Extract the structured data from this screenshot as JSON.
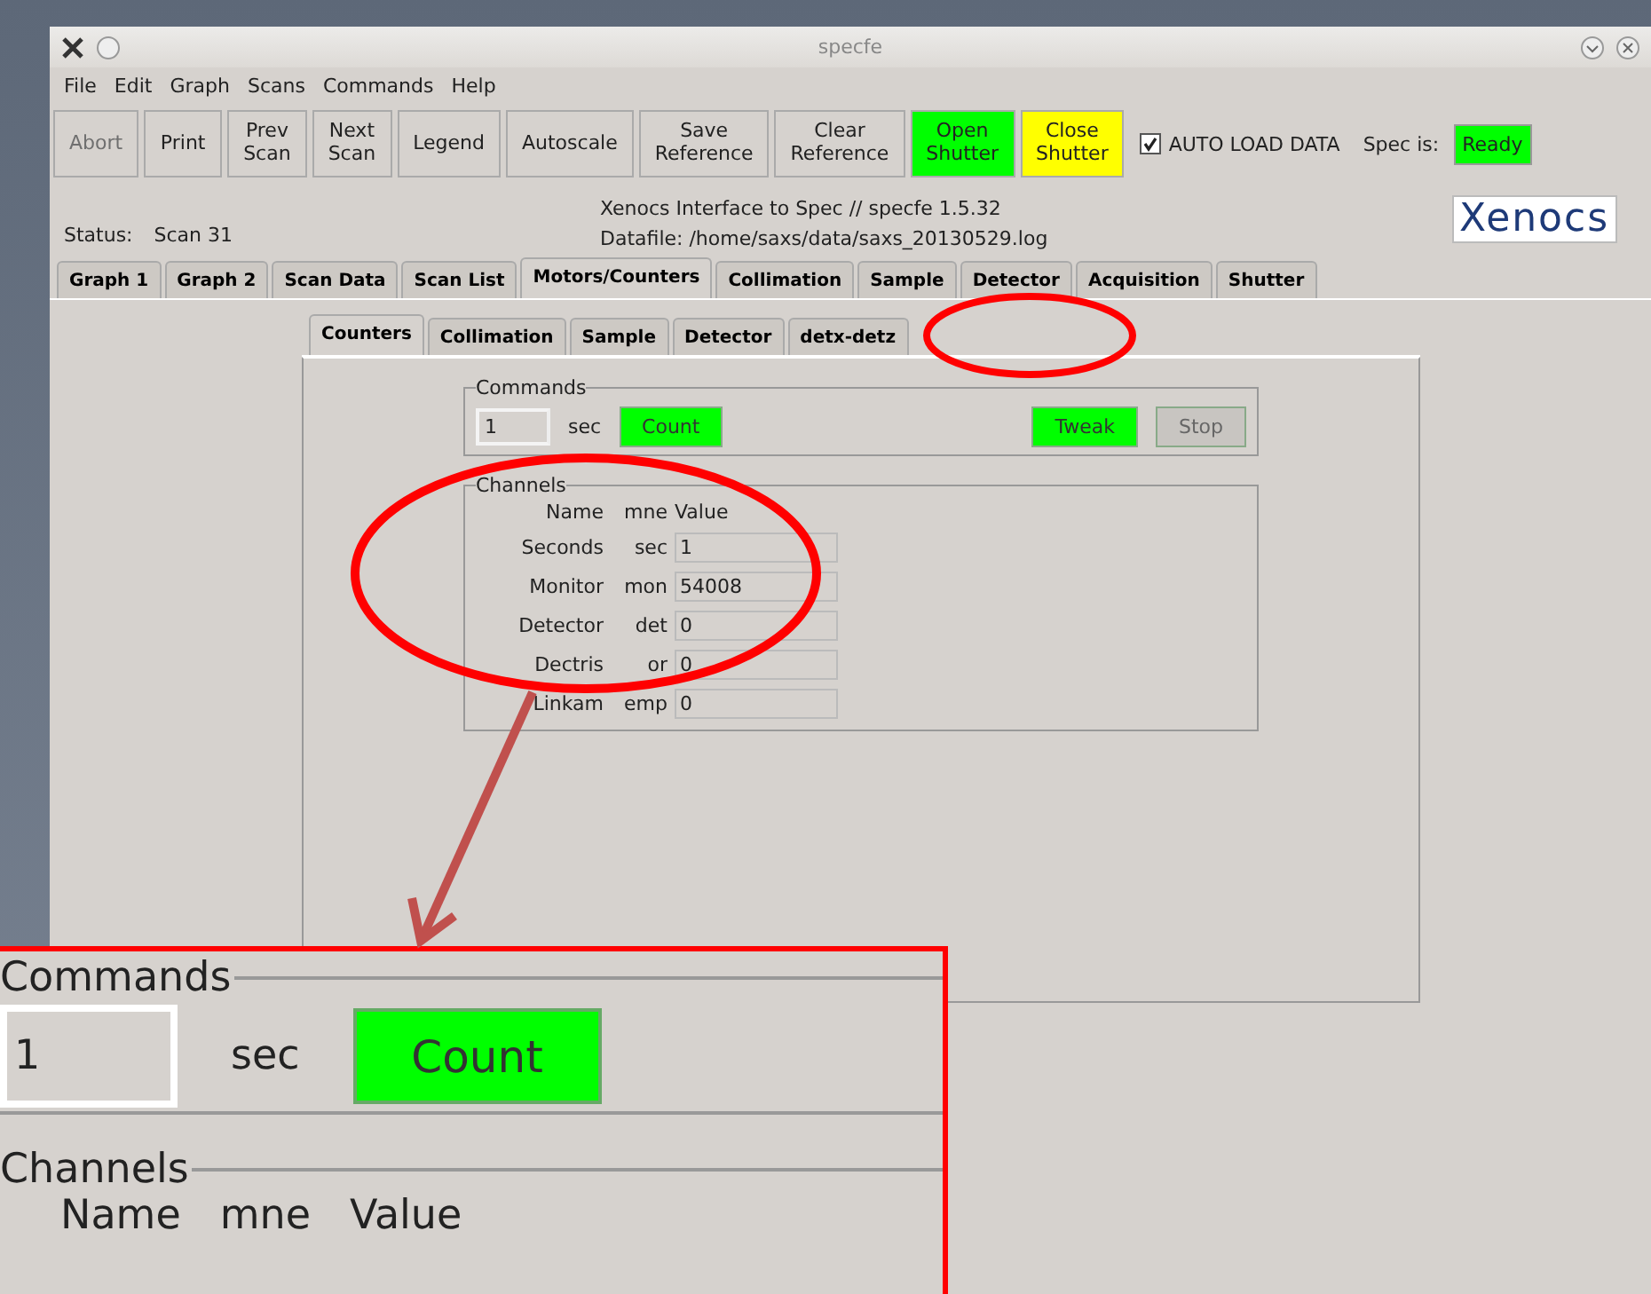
{
  "window": {
    "title": "specfe"
  },
  "menu": [
    "File",
    "Edit",
    "Graph",
    "Scans",
    "Commands",
    "Help"
  ],
  "toolbar": [
    {
      "label": "Abort",
      "color": "#d6d2ce",
      "disabled": true
    },
    {
      "label": "Print",
      "color": "#d6d2ce",
      "disabled": false
    },
    {
      "label": "Prev Scan",
      "color": "#d6d2ce",
      "disabled": false
    },
    {
      "label": "Next Scan",
      "color": "#d6d2ce",
      "disabled": false
    },
    {
      "label": "Legend",
      "color": "#d6d2ce",
      "disabled": false
    },
    {
      "label": "Autoscale",
      "color": "#d6d2ce",
      "disabled": false
    },
    {
      "label": "Save Reference",
      "color": "#d6d2ce",
      "disabled": false
    },
    {
      "label": "Clear Reference",
      "color": "#d6d2ce",
      "disabled": false
    },
    {
      "label": "Open Shutter",
      "color": "#00ff00",
      "disabled": false
    },
    {
      "label": "Close Shutter",
      "color": "#ffff00",
      "disabled": false
    }
  ],
  "auto_load": {
    "label": "AUTO LOAD DATA",
    "checked": true
  },
  "spec_status": {
    "label": "Spec is:",
    "value": "Ready",
    "color": "#00ff00"
  },
  "info": {
    "title": "Xenocs Interface to Spec // specfe 1.5.32",
    "datafile": "Datafile: /home/saxs/data/saxs_20130529.log",
    "status_label": "Status:",
    "status_value": "Scan 31",
    "logo": "Xenocs"
  },
  "tabs": [
    {
      "label": "Graph 1",
      "selected": false
    },
    {
      "label": "Graph 2",
      "selected": false
    },
    {
      "label": "Scan Data",
      "selected": false
    },
    {
      "label": "Scan List",
      "selected": false
    },
    {
      "label": "Motors/Counters",
      "selected": true
    },
    {
      "label": "Collimation",
      "selected": false
    },
    {
      "label": "Sample",
      "selected": false
    },
    {
      "label": "Detector",
      "selected": false
    },
    {
      "label": "Acquisition",
      "selected": false
    },
    {
      "label": "Shutter",
      "selected": false
    }
  ],
  "subtabs": [
    {
      "label": "Counters",
      "selected": true
    },
    {
      "label": "Collimation",
      "selected": false
    },
    {
      "label": "Sample",
      "selected": false
    },
    {
      "label": "Detector",
      "selected": false
    },
    {
      "label": "detx-detz",
      "selected": false
    }
  ],
  "commands": {
    "legend": "Commands",
    "time": "1",
    "unit": "sec",
    "count": {
      "label": "Count",
      "disabled": false
    },
    "actions": [
      {
        "label": "Tweak",
        "disabled": false
      },
      {
        "label": "Stop",
        "disabled": true
      }
    ]
  },
  "channels": {
    "legend": "Channels",
    "headers": [
      "Name",
      "mne",
      "Value"
    ],
    "rows": [
      {
        "name": "Seconds",
        "mne": "sec",
        "value": "1"
      },
      {
        "name": "Monitor",
        "mne": "mon",
        "value": "54008"
      },
      {
        "name": "Detector",
        "mne": "det",
        "value": "0"
      },
      {
        "name": "Dectris",
        "mne": "or",
        "value": "0"
      },
      {
        "name": "Linkam",
        "mne": "emp",
        "value": "0"
      }
    ]
  },
  "inset": {
    "legend": "Commands",
    "time": "1",
    "unit": "sec",
    "button": "Count",
    "legend2": "Channels",
    "headers": [
      "Name",
      "mne",
      "Value"
    ]
  }
}
